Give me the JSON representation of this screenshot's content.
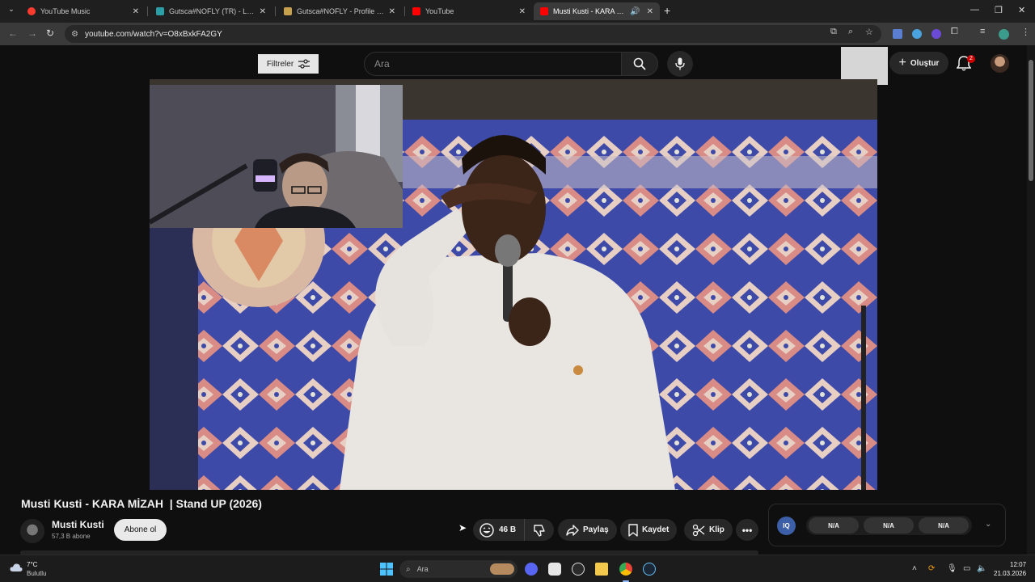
{
  "browser": {
    "tabs": [
      {
        "title": "YouTube Music",
        "favicon_color": "#ff3b30"
      },
      {
        "title": "Gutsca#NOFLY (TR) - LeagueOf",
        "favicon_color": "#2a9fa8"
      },
      {
        "title": "Gutsca#NOFLY - Profile | Maste",
        "favicon_color": "#c7a04b"
      },
      {
        "title": "YouTube",
        "favicon_color": "#ff0000"
      },
      {
        "title": "Musti Kusti - KARA MİZAH",
        "favicon_color": "#ff0000",
        "active": true
      }
    ],
    "url": "youtube.com/watch?v=O8xBxkFA2GY"
  },
  "youtube": {
    "filter_label": "Filtreler",
    "search_placeholder": "Ara",
    "create_label": "Oluştur",
    "notification_count": "2"
  },
  "video": {
    "title": "Musti Kusti - KARA MİZAH  | Stand UP (2026)",
    "channel_name": "Musti Kusti",
    "subscribers": "57,3 B abone",
    "subscribe_label": "Abone ol",
    "like_count": "46 B",
    "share_label": "Paylaş",
    "save_label": "Kaydet",
    "clip_label": "Klip"
  },
  "extension_panel": {
    "badge": "IQ",
    "stats": [
      "N/A",
      "N/A",
      "N/A"
    ]
  },
  "taskbar": {
    "weather_temp": "7°C",
    "weather_desc": "Bulutlu",
    "search_placeholder": "Ara",
    "time": "12:07",
    "date": "21.03.2026"
  },
  "colors": {
    "youtube_bg": "#0f0f0f",
    "pill_bg": "#272727",
    "notification_badge": "#cc0000",
    "browser_frame": "#1f1f1f"
  }
}
